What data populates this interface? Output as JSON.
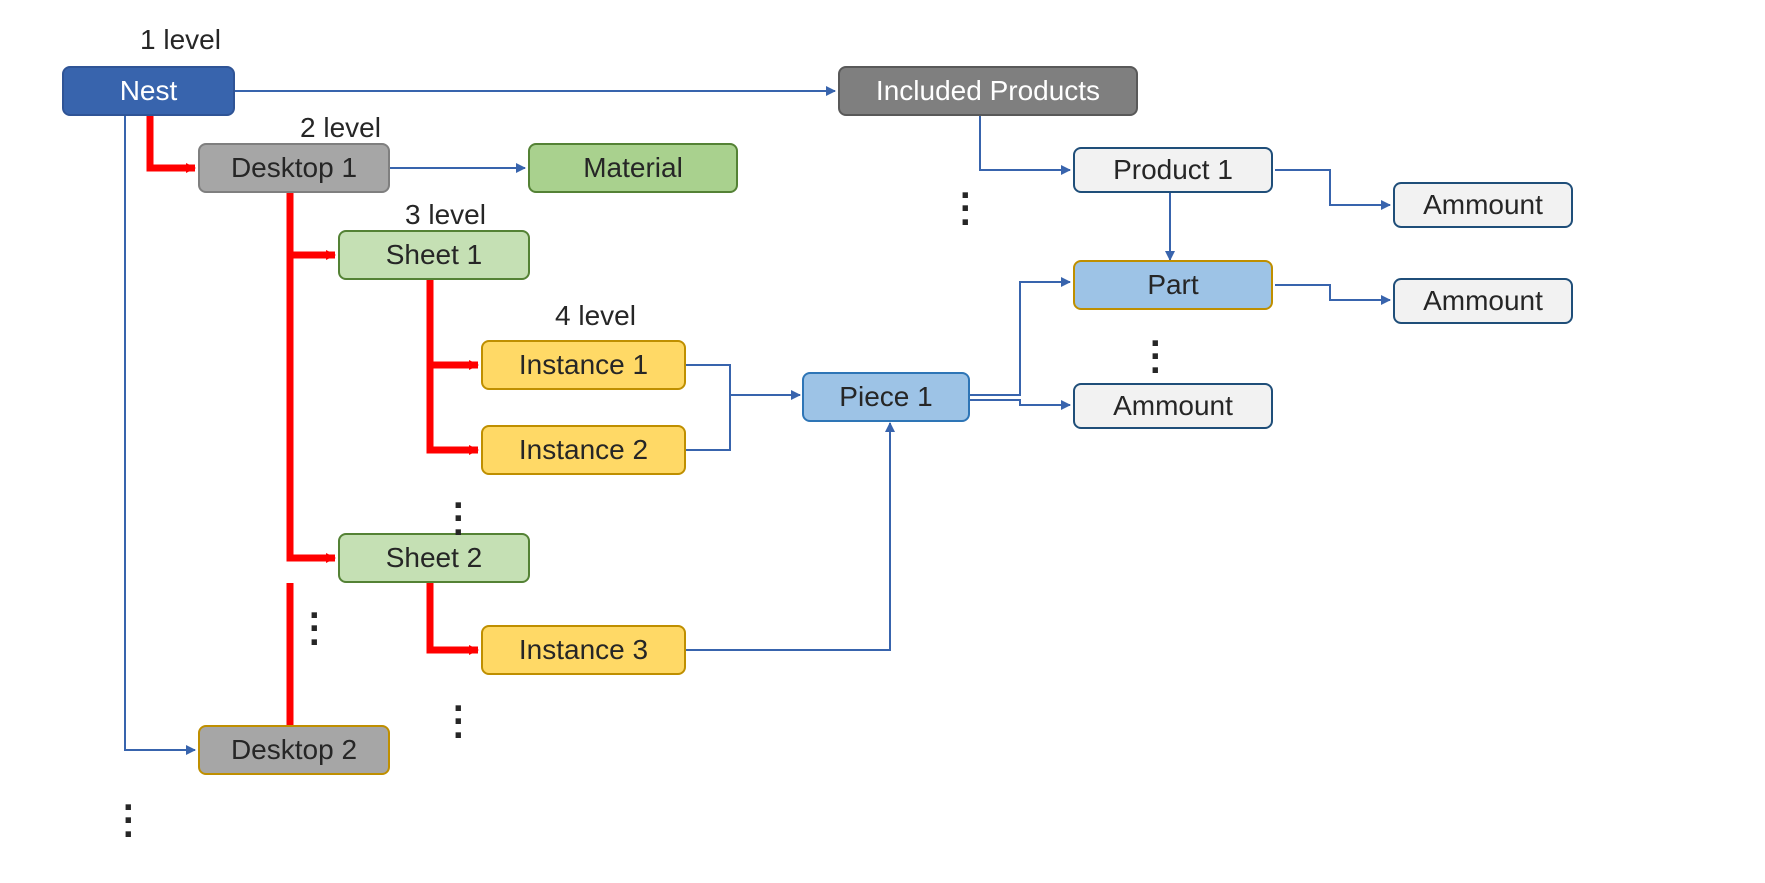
{
  "labels": {
    "level1": "1 level",
    "level2": "2 level",
    "level3": "3 level",
    "level4": "4 level"
  },
  "nodes": {
    "nest": "Nest",
    "desktop1": "Desktop 1",
    "desktop2": "Desktop 2",
    "material": "Material",
    "sheet1": "Sheet 1",
    "sheet2": "Sheet 2",
    "instance1": "Instance 1",
    "instance2": "Instance 2",
    "instance3": "Instance 3",
    "piece1": "Piece 1",
    "included": "Included Products",
    "product1": "Product 1",
    "part": "Part",
    "ammount_top": "Ammount",
    "ammount_mid": "Ammount",
    "ammount_bottom": "Ammount"
  },
  "dots": "⋮",
  "colors": {
    "red_stroke": "#ff0000",
    "blue_stroke": "#3864ad"
  }
}
